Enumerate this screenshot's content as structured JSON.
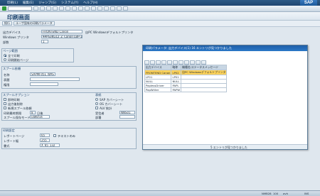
{
  "menubar": {
    "items": [
      "印刷(L)",
      "編集(E)",
      "ジャンプ(G)",
      "システム(Y)",
      "ヘルプ(H)"
    ]
  },
  "toolbar": {
    "ok_icon": "enter-icon",
    "buttons": [
      "save-icon",
      "back-icon",
      "exit-icon",
      "cancel-icon",
      "print-icon",
      "find-icon",
      "find-next-icon",
      "first-page-icon",
      "prev-page-icon",
      "next-page-icon",
      "last-page-icon",
      "new-session-icon",
      "shortcut-icon",
      "help-icon",
      "layout-icon"
    ]
  },
  "brand": {
    "logo_text": "SAP"
  },
  "title": "印刷画面",
  "apptoolbar": {
    "buttons": [
      "続行",
      "ユーザ固有の印刷パラメータ"
    ]
  },
  "form": {
    "output_device_label": "出力デバイス",
    "output_device_value": "FRONTEND Canon",
    "output_device_desc": "自PC Windowsデフォルトプリンタ",
    "windows_printer_label": "Windows プリンタ",
    "windows_printer_value": "¥¥PS3KG12_Z_Canon LBP-1710",
    "copies_label": "部数",
    "copies_value": "1",
    "page_range_title": "ページ範囲",
    "page_range_all": "全て印刷",
    "page_range_pages": "印刷開始ページ",
    "spool_title": "スプール依頼",
    "spool_name_label": "名称",
    "spool_name_value": "SAPMF05L_WAS",
    "spool_title_label": "表題",
    "spool_auth_label": "権限",
    "spool_options_title": "スプールオプション",
    "opt_print_now": "即時印刷",
    "opt_delete_after": "出力後削除",
    "opt_new_spool": "新規スプール依頼",
    "opt_delete_label": "印刷最終期限",
    "opt_delete_value": "8",
    "opt_delete_unit": "日後",
    "opt_spool_mode": "スプール保存モード",
    "opt_spool_mode_value": "印刷のみ",
    "cover_title": "表紙",
    "cover_sap": "SAP カバーシート",
    "cover_os": "OS カバーシート",
    "cover_alv": "ALV 統計",
    "recipient_label": "受信者",
    "recipient_value": "NNS01",
    "dept_label": "部署",
    "print_settings_title": "印刷設定",
    "pages_label": "レポートページ",
    "pages_value": "65",
    "width_label": "レポート幅",
    "width_value": "255",
    "text_only": "テキストのみ",
    "format_label": "書式",
    "format_value": "X_65_132"
  },
  "popup": {
    "title": "印刷パラメータ: 出力デバイス(1) 16 エントリが見つかりました",
    "toolbar": [
      "check-icon",
      "cancel-icon",
      "find-icon",
      "sort-asc-icon",
      "sort-desc-icon",
      "filter-icon",
      "sum-icon",
      "layout-icon",
      "export-icon",
      "help-icon",
      "close-icon"
    ],
    "columns": [
      "出力デバイス",
      "略称",
      "機種名/ステータスメッセージ"
    ],
    "rows": [
      [
        "FRONTEND Canon",
        "LP02",
        "自PC Windowsデフォルトプリンタ"
      ],
      [
        "LP01",
        "LP01",
        ""
      ],
      [
        "NULL",
        "NULL",
        ""
      ],
      [
        "PaplessDriver",
        "PAPL",
        ""
      ],
      [
        "PapWriter",
        "PAPW",
        ""
      ]
    ],
    "status": "5 エントリが見つかりました"
  },
  "statusbar": {
    "system": "NMB28",
    "client": "100",
    "server": "avh",
    "mode": "INS"
  }
}
